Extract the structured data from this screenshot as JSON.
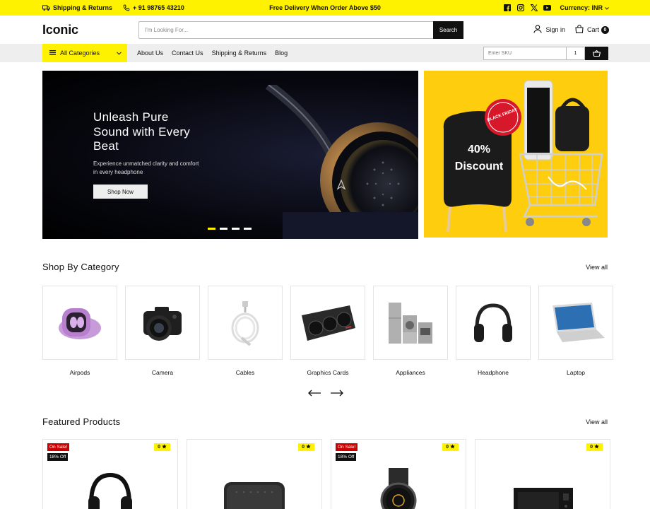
{
  "topbar": {
    "shipping": "Shipping & Returns",
    "phone": "+ 91 98765 43210",
    "promo": "Free Delivery When Order Above $50",
    "currency": "Currency: INR",
    "social_icons": [
      "facebook-icon",
      "instagram-icon",
      "x-icon",
      "youtube-icon"
    ]
  },
  "header": {
    "logo": "Iconic",
    "search_placeholder": "I'm Looking For...",
    "search_button": "Search",
    "signin": "Sign in",
    "cart": "Cart",
    "cart_count": "0"
  },
  "nav": {
    "all_categories": "All Categories",
    "links": [
      "About Us",
      "Contact Us",
      "Shipping & Returns",
      "Blog"
    ],
    "sku_placeholder": "Enter SKU",
    "qty": "1"
  },
  "hero": {
    "title": "Unleash Pure Sound with Every Beat",
    "subtitle": "Experience unmatched clarity and comfort in every headphone",
    "button": "Shop Now",
    "slide_count": 4,
    "active_slide": 1
  },
  "promo": {
    "text": "40% Discount",
    "tag": "BLACK FRIDAY"
  },
  "categories": {
    "title": "Shop By Category",
    "view_all": "View all",
    "items": [
      "Airpods",
      "Camera",
      "Cables",
      "Graphics Cards",
      "Appliances",
      "Headphone",
      "Laptop"
    ]
  },
  "featured": {
    "title": "Featured Products",
    "view_all": "View all",
    "products": [
      {
        "on_sale": "On Sale!",
        "discount": "18% Off",
        "count": "0"
      },
      {
        "count": "0"
      },
      {
        "on_sale": "On Sale!",
        "discount": "18% Off",
        "count": "0"
      },
      {
        "count": "0"
      }
    ]
  },
  "colors": {
    "accent": "#fff200",
    "promo_bg": "#fecd0e",
    "dark": "#111111",
    "sale": "#cc0000"
  }
}
